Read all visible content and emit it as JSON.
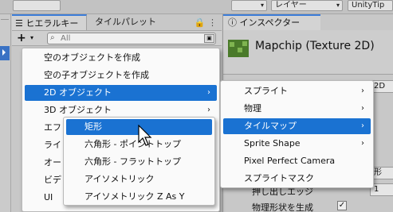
{
  "toolbar": {
    "layers_label": "レイヤー",
    "tips_label": "UnityTip"
  },
  "hierarchy": {
    "tab_label": "ヒエラルキー",
    "tile_palette_tab": "タイルパレット",
    "search_placeholder": "All"
  },
  "inspector": {
    "tab_label": "インスペクター",
    "asset_name": "Mapchip (Texture 2D)",
    "row_label_1": "押し出しエッジ",
    "row_value_1": "1",
    "row_label_2": "物理形状を生成",
    "dropdown_fragment_1": "2D",
    "dropdown_fragment_2": "形"
  },
  "left_menu": {
    "items": [
      {
        "label": "空のオブジェクトを作成"
      },
      {
        "label": "空の子オブジェクトを作成"
      },
      {
        "label": "2D オブジェクト",
        "submenu": true,
        "selected": true
      },
      {
        "label": "3D オブジェクト",
        "submenu": true
      },
      {
        "label": "エフ"
      },
      {
        "label": "ライ"
      },
      {
        "label": "オー"
      },
      {
        "label": "ビデ"
      },
      {
        "label": "UI"
      }
    ]
  },
  "menu_2d": {
    "items": [
      {
        "label": "スプライト",
        "submenu": true
      },
      {
        "label": "物理",
        "submenu": true
      },
      {
        "label": "タイルマップ",
        "submenu": true,
        "selected": true
      },
      {
        "label": "Sprite Shape",
        "submenu": true
      },
      {
        "label": "Pixel Perfect Camera"
      },
      {
        "label": "スプライトマスク"
      }
    ]
  },
  "menu_tilemap": {
    "items": [
      {
        "label": "矩形",
        "selected": true
      },
      {
        "label": "六角形 - ポイントトップ"
      },
      {
        "label": "六角形 - フラットトップ"
      },
      {
        "label": "アイソメトリック"
      },
      {
        "label": "アイソメトリック Z As Y"
      }
    ]
  },
  "colors": {
    "accent": "#1a72d2",
    "panel": "#c8c8c8",
    "menu_bg": "#fafafa"
  }
}
